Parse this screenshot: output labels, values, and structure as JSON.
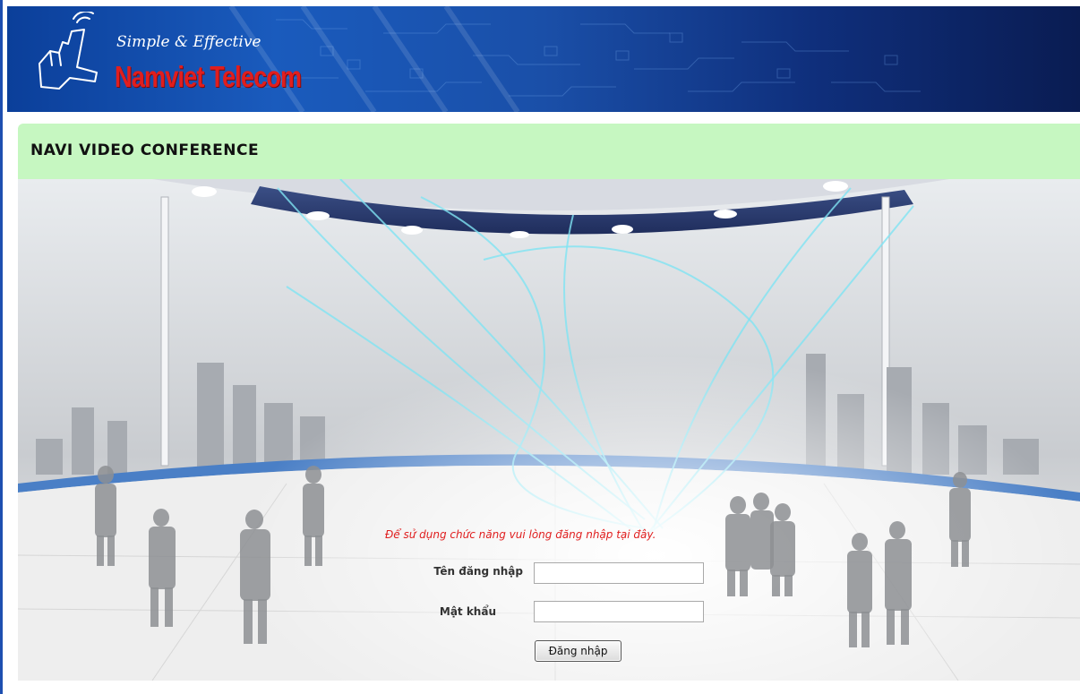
{
  "header": {
    "slogan": "Simple & Effective",
    "brand": "Namviet Telecom"
  },
  "page": {
    "title": "NAVI VIDEO CONFERENCE"
  },
  "login": {
    "message": "Để sử dụng chức năng vui lòng đăng nhập tại đây.",
    "username_label": "Tên đăng nhập",
    "username_value": "",
    "password_label": "Mật khẩu",
    "password_value": "",
    "submit_label": "Đăng nhập"
  },
  "colors": {
    "header_blue": "#1a5bbd",
    "title_bar_green": "#c6f7c1",
    "brand_red": "#e01e1e",
    "message_red": "#e01e1e"
  },
  "icons": {
    "logo": "hand-pointer-logo-icon"
  }
}
